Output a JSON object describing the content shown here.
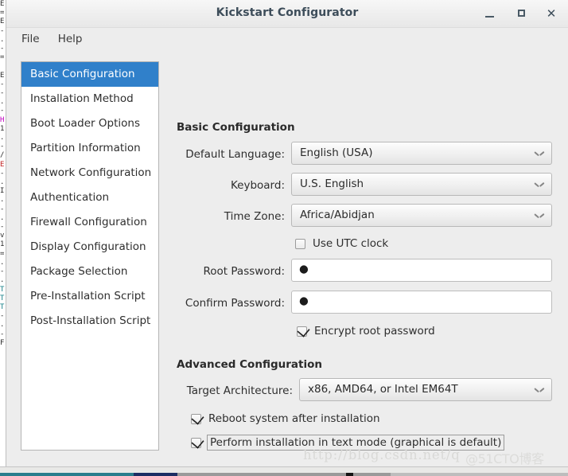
{
  "window": {
    "title": "Kickstart Configurator",
    "controls": {
      "minimize": "minimize-button",
      "maximize": "maximize-button",
      "close": "✕"
    }
  },
  "menubar": {
    "items": [
      {
        "label": "File"
      },
      {
        "label": "Help"
      }
    ]
  },
  "sidebar": {
    "items": [
      {
        "label": "Basic Configuration",
        "selected": true
      },
      {
        "label": "Installation Method",
        "selected": false
      },
      {
        "label": "Boot Loader Options",
        "selected": false
      },
      {
        "label": "Partition Information",
        "selected": false
      },
      {
        "label": "Network Configuration",
        "selected": false
      },
      {
        "label": "Authentication",
        "selected": false
      },
      {
        "label": "Firewall Configuration",
        "selected": false
      },
      {
        "label": "Display Configuration",
        "selected": false
      },
      {
        "label": "Package Selection",
        "selected": false
      },
      {
        "label": "Pre-Installation Script",
        "selected": false
      },
      {
        "label": "Post-Installation Script",
        "selected": false
      }
    ],
    "selected_color": "#3080ca"
  },
  "main": {
    "basic_section_title": "Basic Configuration",
    "advanced_section_title": "Advanced Configuration",
    "labels": {
      "default_language": "Default Language:",
      "keyboard": "Keyboard:",
      "time_zone": "Time Zone:",
      "root_password": "Root Password:",
      "confirm_password": "Confirm Password:",
      "target_architecture": "Target Architecture:"
    },
    "values": {
      "default_language": "English (USA)",
      "keyboard": "U.S. English",
      "time_zone": "Africa/Abidjan",
      "root_password": "●",
      "confirm_password": "●",
      "target_architecture": "x86, AMD64, or Intel EM64T"
    },
    "checkboxes": {
      "use_utc_clock": "Use UTC clock",
      "encrypt_root_password": "Encrypt root password",
      "reboot_after_install": "Reboot system after installation",
      "text_mode": "Perform installation in text mode (graphical is default)"
    }
  },
  "watermarks": {
    "csdn": "http://blog.csdn.net/q",
    "cto": "@51CTO博客"
  },
  "backdrop": {
    "sliver_lines": "E\n=\nE\n-\n.\n-\n=\n\nE\n-\n-\n.\n-\nH\n1\n.\n-\n/\nE\n-\n.\nI\n.\n-\n.\n-\nv\n1\n=\n.\n-\n.\nT\nT\nT\n-\n.\n-\nF"
  }
}
